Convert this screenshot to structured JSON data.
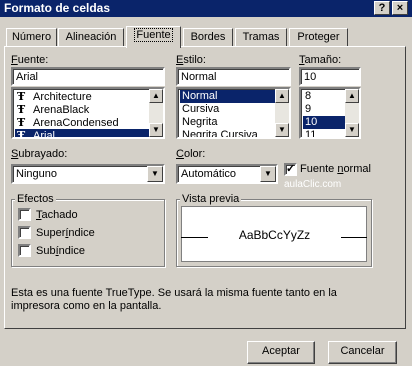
{
  "window": {
    "title": "Formato de celdas",
    "help_label": "?",
    "close_label": "×"
  },
  "tabs": [
    {
      "label": "Número"
    },
    {
      "label": "Alineación"
    },
    {
      "label": "Fuente"
    },
    {
      "label": "Bordes"
    },
    {
      "label": "Tramas"
    },
    {
      "label": "Proteger"
    }
  ],
  "fuente": {
    "label_pre": "",
    "label_key": "F",
    "label_post": "uente:",
    "value": "Arial",
    "items": [
      "Architecture",
      "ArenaBlack",
      "ArenaCondensed",
      "Arial"
    ],
    "selected": "Arial",
    "icon_glyph": "Ŧ"
  },
  "estilo": {
    "label_pre": "",
    "label_key": "E",
    "label_post": "stilo:",
    "value": "Normal",
    "items": [
      "Normal",
      "Cursiva",
      "Negrita",
      "Negrita Cursiva"
    ],
    "selected": "Normal"
  },
  "tamano": {
    "label_pre": "",
    "label_key": "T",
    "label_post": "amaño:",
    "value": "10",
    "items": [
      "8",
      "9",
      "10",
      "11"
    ],
    "selected": "10"
  },
  "subrayado": {
    "label_pre": "",
    "label_key": "S",
    "label_post": "ubrayado:",
    "value": "Ninguno"
  },
  "color": {
    "label_pre": "",
    "label_key": "C",
    "label_post": "olor:",
    "value": "Automático"
  },
  "fuente_normal": {
    "label_pre": "Fuente ",
    "label_key": "n",
    "label_post": "ormal",
    "checked": true
  },
  "watermark": "aulaClic.com",
  "efectos": {
    "legend": "Efectos",
    "tachado": {
      "label_pre": "",
      "label_key": "T",
      "label_post": "achado",
      "checked": false
    },
    "superindice": {
      "label_pre": "Super",
      "label_key": "í",
      "label_post": "ndice",
      "checked": false
    },
    "subindice": {
      "label_pre": "Sub",
      "label_key": "í",
      "label_post": "ndice",
      "checked": false
    }
  },
  "vista_previa": {
    "legend": "Vista previa",
    "sample": "AaBbCcYyZz"
  },
  "info_text": "Esta es una fuente TrueType. Se usará la misma fuente tanto en la impresora como en la pantalla.",
  "buttons": {
    "accept": "Aceptar",
    "cancel": "Cancelar"
  },
  "scroll_glyphs": {
    "up": "▲",
    "down": "▼"
  },
  "colors": {
    "titlebar": "#0a246a",
    "face": "#d4d0c8",
    "selection": "#0a246a"
  }
}
